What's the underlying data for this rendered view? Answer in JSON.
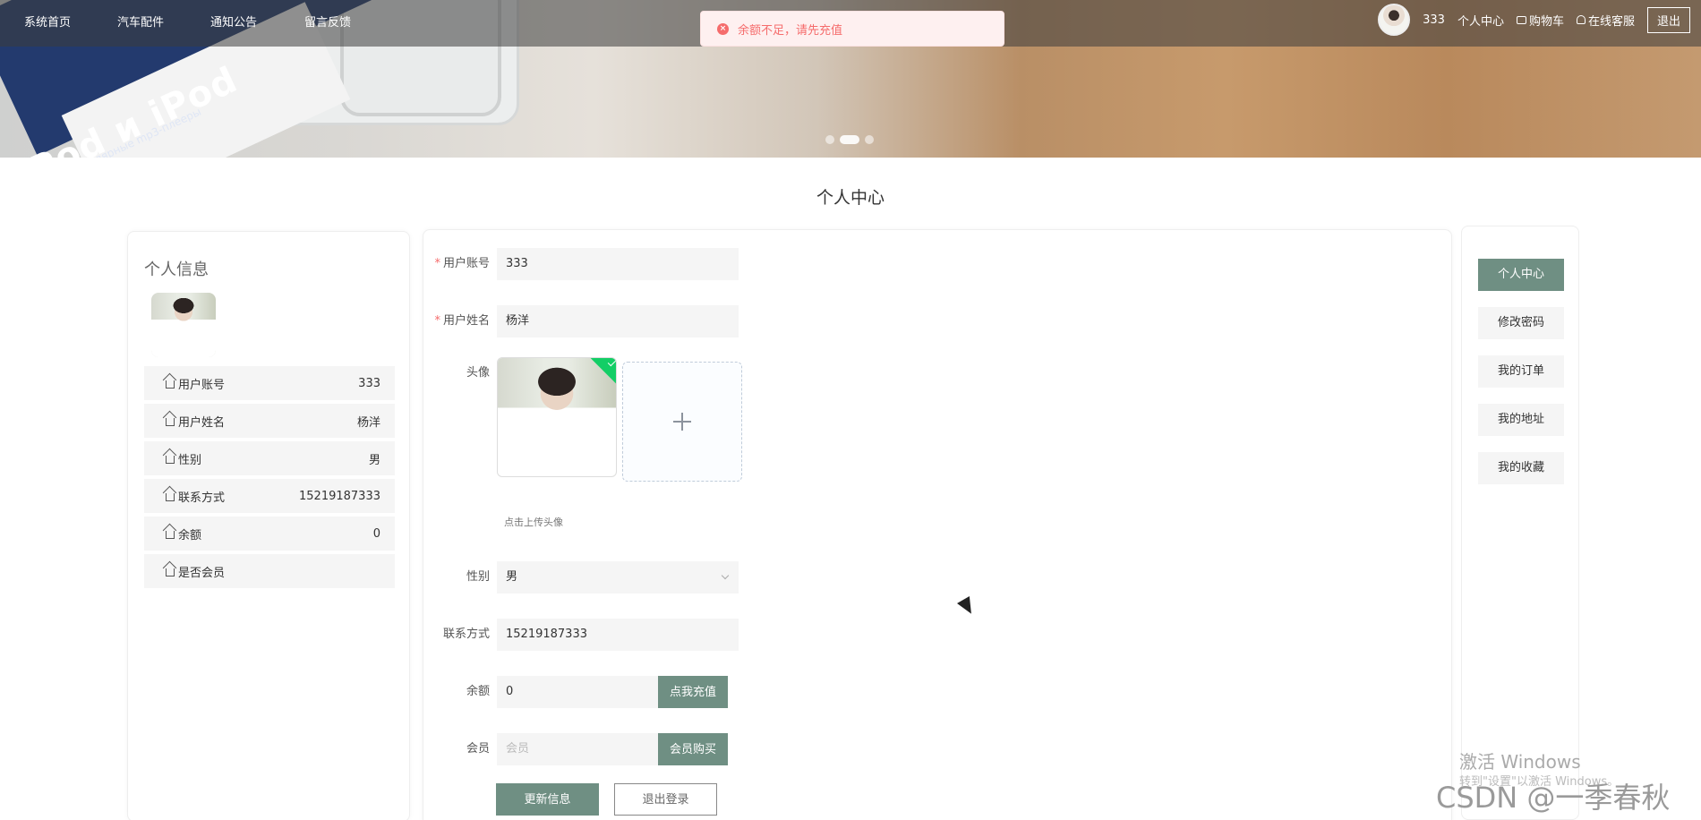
{
  "nav": {
    "links": [
      "系统首页",
      "汽车配件",
      "通知公告",
      "留言反馈"
    ],
    "user": {
      "username": "333",
      "personal_center": "个人中心",
      "cart": "购物车",
      "service": "在线客服",
      "logout": "退出"
    }
  },
  "banner": {
    "box_text": "iPod и iPod",
    "box_sub": "самые популярные mp3-плееры"
  },
  "toast": {
    "message": "余额不足，请先充值"
  },
  "page_title": "个人中心",
  "left_panel": {
    "title": "个人信息",
    "rows": [
      {
        "label": "用户账号",
        "value": "333"
      },
      {
        "label": "用户姓名",
        "value": "杨洋"
      },
      {
        "label": "性别",
        "value": "男"
      },
      {
        "label": "联系方式",
        "value": "15219187333"
      },
      {
        "label": "余额",
        "value": "0"
      },
      {
        "label": "是否会员",
        "value": ""
      }
    ]
  },
  "form": {
    "account_label": "用户账号",
    "account_value": "333",
    "name_label": "用户姓名",
    "name_value": "杨洋",
    "avatar_label": "头像",
    "upload_hint": "点击上传头像",
    "gender_label": "性别",
    "gender_value": "男",
    "phone_label": "联系方式",
    "phone_value": "15219187333",
    "balance_label": "余额",
    "balance_value": "0",
    "recharge_button": "点我充值",
    "member_label": "会员",
    "member_placeholder": "会员",
    "buy_member_button": "会员购买",
    "update_button": "更新信息",
    "logout_button": "退出登录"
  },
  "right_menu": [
    "个人中心",
    "修改密码",
    "我的订单",
    "我的地址",
    "我的收藏"
  ],
  "watermarks": {
    "windows_line1": "激活 Windows",
    "windows_line2": "转到\"设置\"以激活 Windows。",
    "csdn": "CSDN @一季春秋"
  },
  "colors": {
    "accent": "#6f8f83",
    "error": "#f56c6c"
  }
}
